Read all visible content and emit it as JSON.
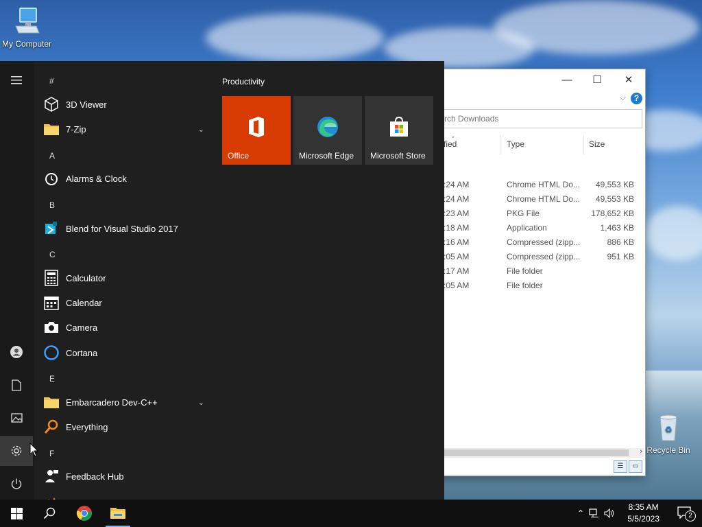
{
  "desktop": {
    "icons": [
      {
        "label": "My Computer"
      },
      {
        "label": "Recycle Bin"
      }
    ]
  },
  "explorer": {
    "search_placeholder": "rch Downloads",
    "columns": {
      "modified": "fied",
      "type": "Type",
      "size": "Size"
    },
    "rows": [
      {
        "time": ":24 AM",
        "type": "Chrome HTML Do...",
        "size": "49,553 KB"
      },
      {
        "time": ":24 AM",
        "type": "Chrome HTML Do...",
        "size": "49,553 KB"
      },
      {
        "time": ":23 AM",
        "type": "PKG File",
        "size": "178,652 KB"
      },
      {
        "time": ":18 AM",
        "type": "Application",
        "size": "1,463 KB"
      },
      {
        "time": ":16 AM",
        "type": "Compressed (zipp...",
        "size": "886 KB"
      },
      {
        "time": ":05 AM",
        "type": "Compressed (zipp...",
        "size": "951 KB"
      },
      {
        "time": ":17 AM",
        "type": "File folder",
        "size": ""
      },
      {
        "time": ":05 AM",
        "type": "File folder",
        "size": ""
      }
    ],
    "help_label": "?"
  },
  "start_menu": {
    "letters": {
      "hash": "#",
      "a": "A",
      "b": "B",
      "c": "C",
      "e": "E",
      "f": "F"
    },
    "apps": {
      "viewer3d": "3D Viewer",
      "zip7": "7-Zip",
      "alarms": "Alarms & Clock",
      "blend": "Blend for Visual Studio 2017",
      "calculator": "Calculator",
      "calendar": "Calendar",
      "camera": "Camera",
      "cortana": "Cortana",
      "devcpp": "Embarcadero Dev-C++",
      "everything": "Everything",
      "feedback": "Feedback Hub"
    },
    "group_title": "Productivity",
    "tiles": [
      {
        "label": "Office",
        "color": "#d83b01"
      },
      {
        "label": "Microsoft Edge",
        "color": "#333333"
      },
      {
        "label": "Microsoft Store",
        "color": "#333333"
      }
    ]
  },
  "taskbar": {
    "time": "8:35 AM",
    "date": "5/5/2023",
    "notification_count": "2"
  }
}
